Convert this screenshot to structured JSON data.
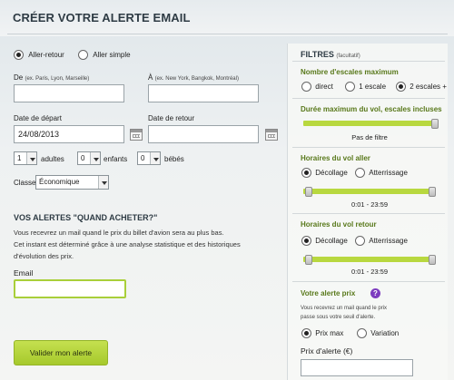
{
  "header": {
    "title": "CRÉER VOTRE ALERTE EMAIL"
  },
  "trip_type": {
    "options": [
      "Aller-retour",
      "Aller simple"
    ],
    "selected": "Aller-retour"
  },
  "origin": {
    "label": "De",
    "hint": "(ex. Paris, Lyon, Marseille)",
    "value": ""
  },
  "destination": {
    "label": "À",
    "hint": "(ex. New York, Bangkok, Montréal)",
    "value": ""
  },
  "departure": {
    "label": "Date de départ",
    "value": "24/08/2013",
    "icon": "calendar-icon"
  },
  "return": {
    "label": "Date de retour",
    "value": "",
    "icon": "calendar-icon"
  },
  "passengers": {
    "adults": {
      "value": "1",
      "label": "adultes"
    },
    "children": {
      "value": "0",
      "label": "enfants"
    },
    "babies": {
      "value": "0",
      "label": "bébés"
    }
  },
  "cabin": {
    "label": "Classe",
    "value": "Économique"
  },
  "when_to_buy": {
    "title": "VOS ALERTES \"QUAND ACHETER?\"",
    "line1": "Vous recevrez un mail quand le prix du billet d'avion sera au plus bas.",
    "line2": "Cet instant est déterminé grâce à une analyse statistique et des historiques",
    "line3": "d'évolution des prix."
  },
  "email": {
    "label": "Email",
    "value": ""
  },
  "submit_label": "Valider mon alerte",
  "filters": {
    "title": "FILTRES",
    "optional": "(facultatif)",
    "stops": {
      "title": "Nombre d'escales maximum",
      "options": [
        "direct",
        "1 escale",
        "2 escales +"
      ],
      "selected": "2 escales +"
    },
    "duration": {
      "title": "Durée maximum du vol, escales incluses",
      "value_text": "Pas de filtre",
      "level": 1.0
    },
    "outbound": {
      "title": "Horaires du vol aller",
      "options": [
        "Décollage",
        "Atterrissage"
      ],
      "selected": "Décollage",
      "range_text": "0:01 - 23:59",
      "range": [
        0.0,
        1.0
      ]
    },
    "inbound": {
      "title": "Horaires du vol retour",
      "options": [
        "Décollage",
        "Atterrissage"
      ],
      "selected": "Décollage",
      "range_text": "0:01 - 23:59",
      "range": [
        0.0,
        1.0
      ]
    },
    "alert_price": {
      "title": "Votre alerte prix",
      "help": "?",
      "line1": "Vous recevrez un mail quand le prix",
      "line2": "passe sous votre seuil d'alerte.",
      "options": [
        "Prix max",
        "Variation"
      ],
      "selected": "Prix max",
      "field_label": "Prix d'alerte (€)",
      "value": ""
    }
  },
  "colors": {
    "accent_green": "#b8d83f",
    "title_green": "#58781a",
    "help_purple": "#7d3dbf"
  }
}
